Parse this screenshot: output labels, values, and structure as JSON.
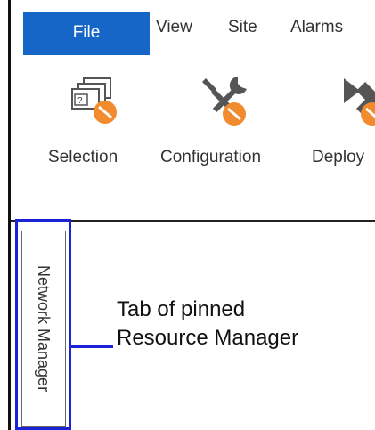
{
  "menu": {
    "file": "File",
    "view": "View",
    "site": "Site",
    "alarms": "Alarms"
  },
  "ribbon": {
    "selection": {
      "label": "Selection",
      "icon": "selection-icon"
    },
    "configuration": {
      "label": "Configuration",
      "icon": "configuration-wrench-icon"
    },
    "deploy": {
      "label": "Deploy",
      "icon": "deploy-icon"
    }
  },
  "side_tab": {
    "label": "Network Manager"
  },
  "callout": {
    "line1": "Tab of pinned",
    "line2": "Resource Manager"
  },
  "colors": {
    "accent": "#1566c7",
    "highlight": "#1a23d6",
    "badge": "#f28a2e"
  }
}
